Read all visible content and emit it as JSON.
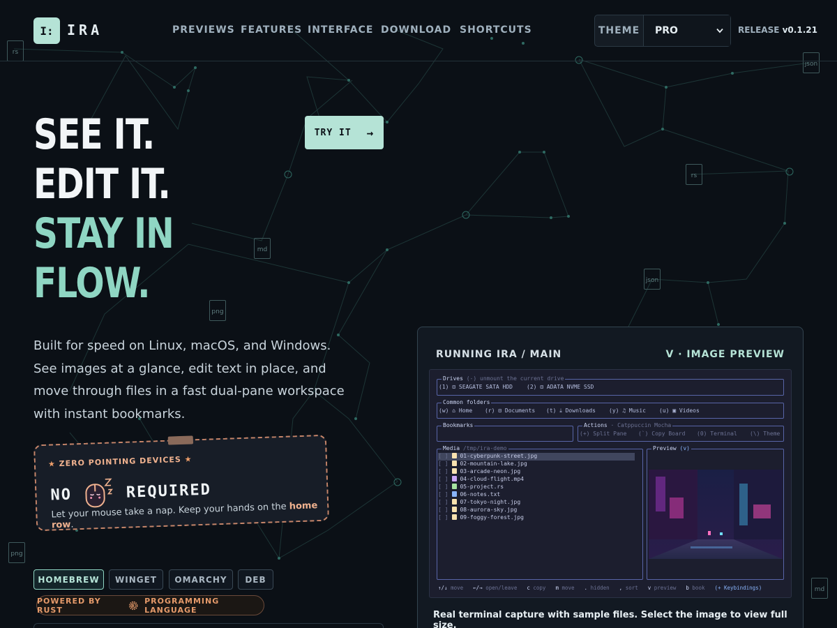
{
  "brand": {
    "mark": "I:",
    "name": "IRA"
  },
  "nav": [
    "PREVIEWS",
    "FEATURES",
    "INTERFACE",
    "DOWNLOAD",
    "SHORTCUTS"
  ],
  "theme": {
    "label": "THEME",
    "value": "PRO"
  },
  "release": {
    "prefix": "RELEASE",
    "version": "v0.1.21"
  },
  "hero": {
    "line1": "SEE IT.",
    "line2": "EDIT IT.",
    "line3": "STAY IN",
    "line4": "FLOW.",
    "accent": "#8fd6c3"
  },
  "try_button": {
    "label": "TRY IT",
    "arrow": "→"
  },
  "description": "Built for speed on Linux, macOS, and Windows. See images at a glance, edit text in place, and move through files in a fast dual-pane workspace with instant bookmarks.",
  "card": {
    "title": "ZERO POINTING DEVICES",
    "big_left": "NO",
    "big_right": "REQUIRED",
    "text_before": "Let your mouse take a nap. Keep your hands on the",
    "text_link": "home row",
    "text_after": "."
  },
  "install_tabs": [
    "HOMEBREW",
    "WINGET",
    "OMARCHY",
    "DEB"
  ],
  "rust_badge": {
    "left": "POWERED BY RUST",
    "right": "PROGRAMMING LANGUAGE"
  },
  "panel": {
    "title": "RUNNING IRA / MAIN",
    "right": "V · IMAGE PREVIEW",
    "caption": "Real terminal capture with sample files. Select the image to view full size."
  },
  "terminal": {
    "drives": {
      "label": "Drives",
      "hint": "(-) unmount the current drive",
      "items": [
        "(1) ⊟ SEAGATE SATA HDD",
        "(2) ⊟ ADATA NVME SSD"
      ]
    },
    "common": {
      "label": "Common folders",
      "items": [
        "(w) ⌂ Home",
        "(r) ⊟ Documents",
        "(t) ⤓ Downloads",
        "(y) ♫ Music",
        "(u) ▣ Videos"
      ]
    },
    "bookmarks": {
      "label": "Bookmarks"
    },
    "actions": {
      "label": "Actions",
      "sub": "· Catppuccin Mocha",
      "items": [
        "(+) Split Pane",
        "(`) Copy Board",
        "(0) Terminal",
        "(\\) Theme"
      ]
    },
    "media": {
      "label": "Media",
      "path": "/tmp/ira-demo"
    },
    "files": [
      {
        "name": "01-cyberpunk-street.jpg",
        "color": "#f9e2af"
      },
      {
        "name": "02-mountain-lake.jpg",
        "color": "#f9e2af"
      },
      {
        "name": "03-arcade-neon.jpg",
        "color": "#f9e2af"
      },
      {
        "name": "04-cloud-flight.mp4",
        "color": "#cba6f7"
      },
      {
        "name": "05-project.rs",
        "color": "#a6e3a1"
      },
      {
        "name": "06-notes.txt",
        "color": "#89b4fa"
      },
      {
        "name": "07-tokyo-night.jpg",
        "color": "#f9e2af"
      },
      {
        "name": "08-aurora-sky.jpg",
        "color": "#f9e2af"
      },
      {
        "name": "09-foggy-forest.jpg",
        "color": "#f9e2af"
      }
    ],
    "preview": {
      "label": "Preview",
      "key": "(v)"
    },
    "keys": [
      {
        "k": "↑/↓",
        "v": "move"
      },
      {
        "k": "←/→",
        "v": "open/leave"
      },
      {
        "k": "c",
        "v": "copy"
      },
      {
        "k": "m",
        "v": "move"
      },
      {
        "k": ".",
        "v": "hidden"
      },
      {
        "k": ",",
        "v": "sort"
      },
      {
        "k": "v",
        "v": "preview"
      },
      {
        "k": "b",
        "v": "book"
      }
    ],
    "keybindings": "(+ Keybindings)"
  },
  "file_icons": [
    "rs",
    "json",
    "rs",
    "md",
    "json",
    "png",
    "png",
    "md"
  ]
}
